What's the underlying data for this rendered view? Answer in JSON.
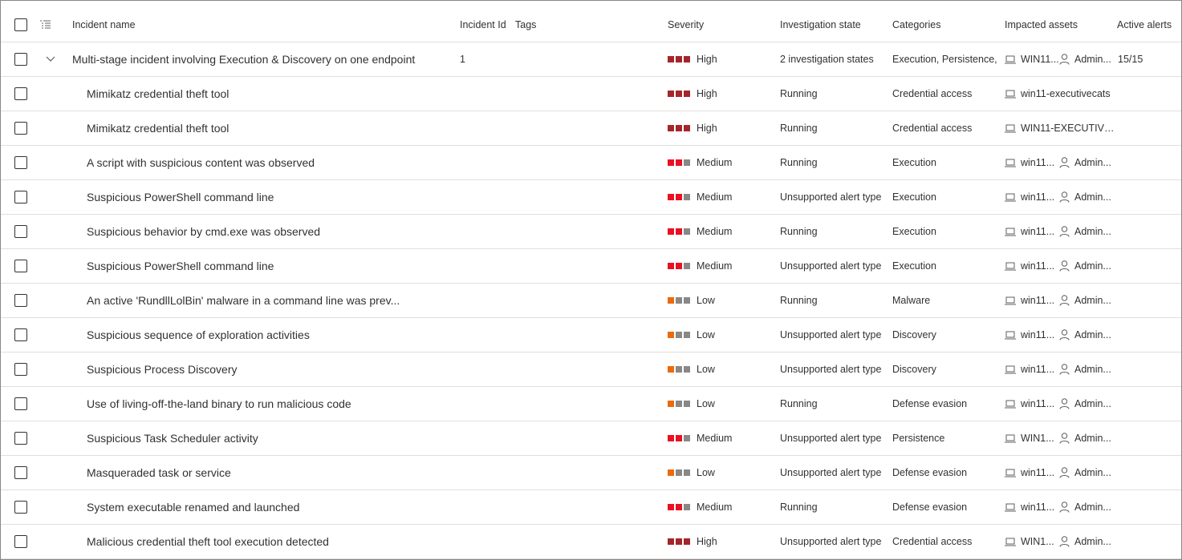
{
  "colors": {
    "high": "#a4262c",
    "medium": "#e81123",
    "low": "#ea6a0c",
    "empty": "#8a8886"
  },
  "header": {
    "incident_name": "Incident name",
    "incident_id": "Incident Id",
    "tags": "Tags",
    "severity": "Severity",
    "investigation_state": "Investigation state",
    "categories": "Categories",
    "impacted_assets": "Impacted assets",
    "active_alerts": "Active alerts"
  },
  "incident": {
    "name": "Multi-stage incident involving Execution & Discovery on one endpoint",
    "id": "1",
    "severity": "High",
    "investigation_state": "2 investigation states",
    "categories": "Execution, Persistence, ...",
    "device": "WIN11...",
    "user": "Admin...",
    "active_alerts": "15/15"
  },
  "alerts": [
    {
      "name": "Mimikatz credential theft tool",
      "severity": "High",
      "state": "Running",
      "category": "Credential access",
      "device": "win11-executivecats",
      "user": ""
    },
    {
      "name": "Mimikatz credential theft tool",
      "severity": "High",
      "state": "Running",
      "category": "Credential access",
      "device": "WIN11-EXECUTIVE...",
      "user": ""
    },
    {
      "name": "A script with suspicious content was observed",
      "severity": "Medium",
      "state": "Running",
      "category": "Execution",
      "device": "win11...",
      "user": "Admin..."
    },
    {
      "name": "Suspicious PowerShell command line",
      "severity": "Medium",
      "state": "Unsupported alert type",
      "category": "Execution",
      "device": "win11...",
      "user": "Admin..."
    },
    {
      "name": "Suspicious behavior by cmd.exe was observed",
      "severity": "Medium",
      "state": "Running",
      "category": "Execution",
      "device": "win11...",
      "user": "Admin..."
    },
    {
      "name": "Suspicious PowerShell command line",
      "severity": "Medium",
      "state": "Unsupported alert type",
      "category": "Execution",
      "device": "win11...",
      "user": "Admin..."
    },
    {
      "name": "An active 'RundllLolBin' malware in a command line was prev...",
      "severity": "Low",
      "state": "Running",
      "category": "Malware",
      "device": "win11...",
      "user": "Admin..."
    },
    {
      "name": "Suspicious sequence of exploration activities",
      "severity": "Low",
      "state": "Unsupported alert type",
      "category": "Discovery",
      "device": "win11...",
      "user": "Admin..."
    },
    {
      "name": "Suspicious Process Discovery",
      "severity": "Low",
      "state": "Unsupported alert type",
      "category": "Discovery",
      "device": "win11...",
      "user": "Admin..."
    },
    {
      "name": "Use of living-off-the-land binary to run malicious code",
      "severity": "Low",
      "state": "Running",
      "category": "Defense evasion",
      "device": "win11...",
      "user": "Admin..."
    },
    {
      "name": "Suspicious Task Scheduler activity",
      "severity": "Medium",
      "state": "Unsupported alert type",
      "category": "Persistence",
      "device": "WIN1...",
      "user": "Admin..."
    },
    {
      "name": "Masqueraded task or service",
      "severity": "Low",
      "state": "Unsupported alert type",
      "category": "Defense evasion",
      "device": "win11...",
      "user": "Admin..."
    },
    {
      "name": "System executable renamed and launched",
      "severity": "Medium",
      "state": "Running",
      "category": "Defense evasion",
      "device": "win11...",
      "user": "Admin..."
    },
    {
      "name": "Malicious credential theft tool execution detected",
      "severity": "High",
      "state": "Unsupported alert type",
      "category": "Credential access",
      "device": "WIN1...",
      "user": "Admin..."
    }
  ]
}
